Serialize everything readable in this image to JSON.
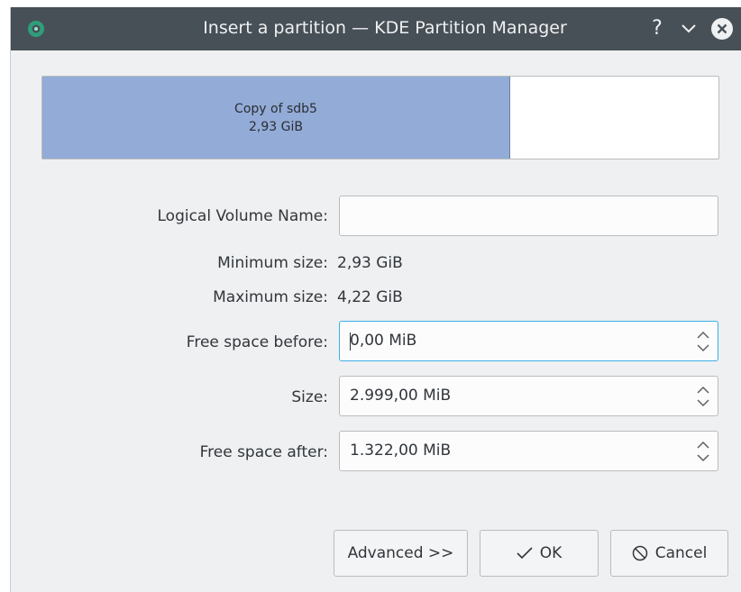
{
  "window": {
    "title": "Insert a partition — KDE Partition Manager",
    "help_icon": "?",
    "minimize_icon": "chevron-down",
    "close_icon": "close-circle"
  },
  "partition_graph": {
    "name": "Copy of sdb5",
    "size": "2,93 GiB",
    "used_fraction": 0.69,
    "color": "#93abd7"
  },
  "form": {
    "lv_name_label": "Logical Volume Name:",
    "lv_name_value": "",
    "min_size_label": "Minimum size:",
    "min_size_value": "2,93 GiB",
    "max_size_label": "Maximum size:",
    "max_size_value": "4,22 GiB",
    "free_before_label": "Free space before:",
    "free_before_value": "0,00 MiB",
    "size_label": "Size:",
    "size_value": "2.999,00 MiB",
    "free_after_label": "Free space after:",
    "free_after_value": "1.322,00 MiB"
  },
  "buttons": {
    "advanced": "Advanced >>",
    "ok": "OK",
    "cancel": "Cancel"
  },
  "colors": {
    "titlebar": "#475057",
    "accent_focus": "#3daee9"
  }
}
